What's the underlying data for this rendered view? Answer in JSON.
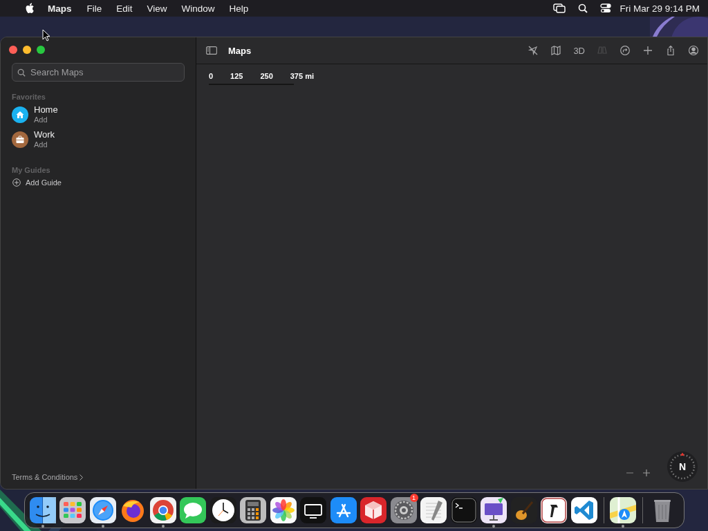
{
  "menu_bar": {
    "app_name": "Maps",
    "menus": [
      "File",
      "Edit",
      "View",
      "Window",
      "Help"
    ],
    "clock": "Fri Mar 29  9:14 PM"
  },
  "window": {
    "title": "Maps",
    "sidebar": {
      "search": {
        "placeholder": "Search Maps"
      },
      "sections": [
        {
          "heading": "Favorites",
          "items": [
            {
              "kind": "home",
              "title": "Home",
              "subtitle": "Add"
            },
            {
              "kind": "work",
              "title": "Work",
              "subtitle": "Add"
            }
          ]
        },
        {
          "heading": "My Guides",
          "items": [
            {
              "kind": "add",
              "title": "Add Guide"
            }
          ]
        }
      ],
      "footer_link": "Terms & Conditions"
    },
    "toolbar": [
      {
        "kind": "location",
        "disabled": false
      },
      {
        "kind": "map",
        "disabled": false
      },
      {
        "kind": "text",
        "label": "3D",
        "disabled": false
      },
      {
        "kind": "binoculars",
        "disabled": true
      },
      {
        "kind": "directions",
        "disabled": false
      },
      {
        "kind": "plus",
        "disabled": false
      },
      {
        "kind": "share",
        "disabled": false
      },
      {
        "kind": "account",
        "disabled": false
      }
    ],
    "scale": [
      "0",
      "125",
      "250",
      "375 mi"
    ],
    "compass": "N"
  },
  "dock": [
    {
      "kind": "finder",
      "running": true
    },
    {
      "kind": "launchpad",
      "running": false
    },
    {
      "kind": "safari",
      "running": true
    },
    {
      "kind": "firefox",
      "running": false
    },
    {
      "kind": "chrome",
      "running": true
    },
    {
      "kind": "messages",
      "running": false
    },
    {
      "kind": "clock",
      "running": false
    },
    {
      "kind": "calculator",
      "running": false
    },
    {
      "kind": "photos",
      "running": false
    },
    {
      "kind": "tv",
      "running": false
    },
    {
      "kind": "appstore",
      "running": false
    },
    {
      "kind": "cube",
      "running": false
    },
    {
      "kind": "settings",
      "running": false,
      "badge": "1"
    },
    {
      "kind": "textedit",
      "running": false
    },
    {
      "kind": "terminal",
      "running": false
    },
    {
      "kind": "presentation",
      "running": true
    },
    {
      "kind": "guitar",
      "running": false
    },
    {
      "kind": "hammer",
      "running": false
    },
    {
      "kind": "vscode",
      "running": false
    },
    {
      "kind": "divider"
    },
    {
      "kind": "maps",
      "running": true
    },
    {
      "kind": "divider"
    },
    {
      "kind": "trash",
      "running": false
    }
  ]
}
